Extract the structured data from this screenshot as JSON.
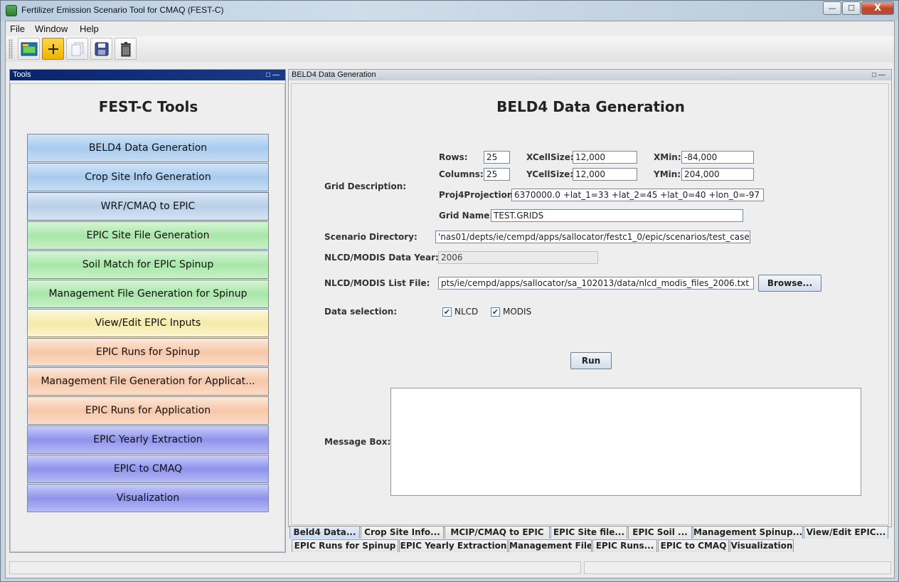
{
  "window": {
    "title": "Fertilizer Emission Scenario Tool for CMAQ (FEST-C)",
    "min": "—",
    "max": "☐",
    "close": "X"
  },
  "menu": [
    "File",
    "Window",
    "Help"
  ],
  "toolbar_icons": [
    "open-folder-icon",
    "add-icon",
    "copy-icon",
    "save-icon",
    "delete-icon"
  ],
  "tools_panel": {
    "header": "Tools",
    "heading": "FEST-C Tools",
    "buttons": [
      {
        "label": "BELD4 Data Generation",
        "color": "blue"
      },
      {
        "label": "Crop Site Info Generation",
        "color": "blue"
      },
      {
        "label": "WRF/CMAQ to EPIC",
        "color": "blue2"
      },
      {
        "label": "EPIC Site File Generation",
        "color": "green"
      },
      {
        "label": "Soil Match for EPIC Spinup",
        "color": "green"
      },
      {
        "label": "Management File Generation for Spinup",
        "color": "green"
      },
      {
        "label": "View/Edit EPIC Inputs",
        "color": "yellow"
      },
      {
        "label": "EPIC Runs for Spinup",
        "color": "peach"
      },
      {
        "label": "Management File Generation for Applicat...",
        "color": "peach"
      },
      {
        "label": "EPIC Runs for Application",
        "color": "peach"
      },
      {
        "label": "EPIC Yearly Extraction",
        "color": "purple"
      },
      {
        "label": "EPIC to CMAQ",
        "color": "purple"
      },
      {
        "label": "Visualization",
        "color": "purple"
      }
    ]
  },
  "main_panel": {
    "header": "BELD4 Data Generation",
    "heading": "BELD4 Data Generation",
    "grid_description_label": "Grid Description:",
    "rows_label": "Rows:",
    "rows_value": "25",
    "columns_label": "Columns:",
    "columns_value": "25",
    "xcell_label": "XCellSize:",
    "xcell_value": "12,000",
    "ycell_label": "YCellSize:",
    "ycell_value": "12,000",
    "xmin_label": "XMin:",
    "xmin_value": "-84,000",
    "ymin_label": "YMin:",
    "ymin_value": "204,000",
    "proj_label": "Proj4Projection:",
    "proj_value": "6370000.0 +lat_1=33 +lat_2=45 +lat_0=40 +lon_0=-97",
    "gridname_label": "Grid Name:",
    "gridname_value": "TEST.GRIDS",
    "scenario_label": "Scenario Directory:",
    "scenario_value": "'nas01/depts/ie/cempd/apps/sallocator/festc1_0/epic/scenarios/test_case",
    "datayear_label": "NLCD/MODIS Data Year:",
    "datayear_value": "2006",
    "listfile_label": "NLCD/MODIS List File:",
    "listfile_value": "pts/ie/cempd/apps/sallocator/sa_102013/data/nlcd_modis_files_2006.txt",
    "browse_label": "Browse...",
    "datasel_label": "Data selection:",
    "nlcd_label": "NLCD",
    "nlcd_checked": true,
    "modis_label": "MODIS",
    "modis_checked": true,
    "run_label": "Run",
    "message_label": "Message Box:",
    "message_text": ""
  },
  "tabs_row1": [
    "Beld4 Data...",
    "Crop Site Info...",
    "MCIP/CMAQ to EPIC",
    "EPIC Site file...",
    "EPIC Soil ...",
    "Management Spinup...",
    "View/Edit EPIC..."
  ],
  "tabs_row2": [
    "EPIC Runs for Spinup",
    "EPIC Yearly Extraction",
    "Management File...",
    "EPIC Runs...",
    "EPIC to CMAQ",
    "Visualization"
  ],
  "selected_tab": "Beld4 Data...",
  "check_glyph": "✔",
  "colors": {
    "pane_header_active": "#0a246a",
    "pane_header_inactive": "#c8ced6"
  }
}
